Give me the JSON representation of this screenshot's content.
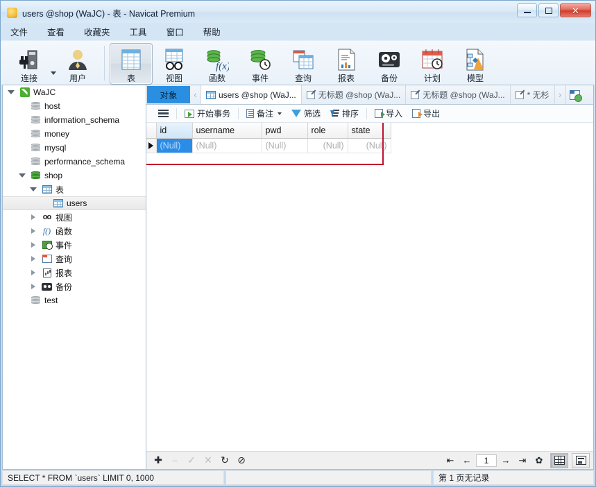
{
  "window": {
    "title": "users @shop (WaJC) - 表 - Navicat Premium",
    "icon": "app-icon",
    "minimize_label": "最小化",
    "maximize_label": "最大化",
    "close_label": "关闭"
  },
  "menu": {
    "items": [
      {
        "label": "文件",
        "name": "menu-file"
      },
      {
        "label": "查看",
        "name": "menu-view"
      },
      {
        "label": "收藏夹",
        "name": "menu-favorites"
      },
      {
        "label": "工具",
        "name": "menu-tools"
      },
      {
        "label": "窗口",
        "name": "menu-window"
      },
      {
        "label": "帮助",
        "name": "menu-help"
      }
    ]
  },
  "toolbar": {
    "items": [
      {
        "label": "连接",
        "icon": "connection-icon",
        "selected": false
      },
      {
        "label": "用户",
        "icon": "user-icon",
        "selected": false
      },
      {
        "label": "表",
        "icon": "table-icon",
        "selected": true
      },
      {
        "label": "视图",
        "icon": "view-icon",
        "selected": false
      },
      {
        "label": "函数",
        "icon": "function-icon",
        "selected": false
      },
      {
        "label": "事件",
        "icon": "event-icon",
        "selected": false
      },
      {
        "label": "查询",
        "icon": "query-icon",
        "selected": false
      },
      {
        "label": "报表",
        "icon": "report-icon",
        "selected": false
      },
      {
        "label": "备份",
        "icon": "backup-icon",
        "selected": false
      },
      {
        "label": "计划",
        "icon": "schedule-icon",
        "selected": false
      },
      {
        "label": "模型",
        "icon": "model-icon",
        "selected": false
      }
    ]
  },
  "sidebar": {
    "tree": [
      {
        "label": "WaJC",
        "indent": 0,
        "icon": "connection",
        "expander": "open",
        "selected": false
      },
      {
        "label": "host",
        "indent": 1,
        "icon": "db-grey",
        "expander": "none",
        "selected": false
      },
      {
        "label": "information_schema",
        "indent": 1,
        "icon": "db-grey",
        "expander": "none",
        "selected": false
      },
      {
        "label": "money",
        "indent": 1,
        "icon": "db-grey",
        "expander": "none",
        "selected": false
      },
      {
        "label": "mysql",
        "indent": 1,
        "icon": "db-grey",
        "expander": "none",
        "selected": false
      },
      {
        "label": "performance_schema",
        "indent": 1,
        "icon": "db-grey",
        "expander": "none",
        "selected": false
      },
      {
        "label": "shop",
        "indent": 1,
        "icon": "db-green",
        "expander": "open",
        "selected": false
      },
      {
        "label": "表",
        "indent": 2,
        "icon": "table",
        "expander": "open",
        "selected": false
      },
      {
        "label": "users",
        "indent": 3,
        "icon": "table",
        "expander": "none",
        "selected": true
      },
      {
        "label": "视图",
        "indent": 2,
        "icon": "view",
        "expander": "closed",
        "selected": false
      },
      {
        "label": "函数",
        "indent": 2,
        "icon": "function",
        "expander": "closed",
        "selected": false
      },
      {
        "label": "事件",
        "indent": 2,
        "icon": "event",
        "expander": "closed",
        "selected": false
      },
      {
        "label": "查询",
        "indent": 2,
        "icon": "query",
        "expander": "closed",
        "selected": false
      },
      {
        "label": "报表",
        "indent": 2,
        "icon": "report",
        "expander": "closed",
        "selected": false
      },
      {
        "label": "备份",
        "indent": 2,
        "icon": "backup",
        "expander": "closed",
        "selected": false
      },
      {
        "label": "test",
        "indent": 1,
        "icon": "db-grey",
        "expander": "none",
        "selected": false
      }
    ]
  },
  "tabs": {
    "objects_label": "对象",
    "documents": [
      {
        "label": "users @shop (WaJ...",
        "icon": "table-icon",
        "active": true
      },
      {
        "label": "无标题 @shop (WaJ...",
        "icon": "query-icon",
        "active": false
      },
      {
        "label": "无标题 @shop (WaJ...",
        "icon": "query-icon",
        "active": false
      },
      {
        "label": "* 无杉",
        "icon": "query-icon",
        "active": false
      }
    ],
    "scroll_right_label": "›",
    "new_tab_label": "新建"
  },
  "data_toolbar": {
    "menu_label": "",
    "items": [
      {
        "label": "开始事务",
        "icon": "begin-transaction-icon",
        "dropdown": false
      },
      {
        "label": "备注",
        "icon": "note-icon",
        "dropdown": true
      },
      {
        "label": "筛选",
        "icon": "filter-icon",
        "dropdown": false
      },
      {
        "label": "排序",
        "icon": "sort-icon",
        "dropdown": false
      },
      {
        "label": "导入",
        "icon": "import-icon",
        "dropdown": false
      },
      {
        "label": "导出",
        "icon": "export-icon",
        "dropdown": false
      }
    ]
  },
  "grid": {
    "columns": [
      {
        "label": "id",
        "width": 52,
        "align": "left",
        "highlighted": true
      },
      {
        "label": "username",
        "width": 100,
        "align": "left",
        "highlighted": false
      },
      {
        "label": "pwd",
        "width": 66,
        "align": "left",
        "highlighted": false
      },
      {
        "label": "role",
        "width": 58,
        "align": "right",
        "highlighted": false
      },
      {
        "label": "state",
        "width": 62,
        "align": "right",
        "highlighted": false
      }
    ],
    "rows": [
      {
        "indicator": "current-row",
        "cells": [
          {
            "value": "(Null)",
            "selected": true,
            "align": "left"
          },
          {
            "value": "(Null)",
            "selected": false,
            "align": "left"
          },
          {
            "value": "(Null)",
            "selected": false,
            "align": "left"
          },
          {
            "value": "(Null)",
            "selected": false,
            "align": "right"
          },
          {
            "value": "(Null)",
            "selected": false,
            "align": "right"
          }
        ]
      }
    ],
    "annotation_color": "#c0112f"
  },
  "bottombar": {
    "record_actions": [
      {
        "icon": "add-record-icon",
        "glyph": "✚",
        "enabled": true
      },
      {
        "icon": "delete-record-icon",
        "glyph": "−",
        "enabled": false
      },
      {
        "icon": "apply-change-icon",
        "glyph": "✓",
        "enabled": false
      },
      {
        "icon": "cancel-change-icon",
        "glyph": "✕",
        "enabled": false
      },
      {
        "icon": "refresh-icon",
        "glyph": "↻",
        "enabled": true
      },
      {
        "icon": "stop-icon",
        "glyph": "⊘",
        "enabled": true
      }
    ],
    "nav": [
      {
        "icon": "first-record-icon",
        "glyph": "⇤"
      },
      {
        "icon": "prev-record-icon",
        "glyph": "←"
      },
      {
        "icon": "next-record-icon",
        "glyph": "→"
      },
      {
        "icon": "last-record-icon",
        "glyph": "⇥"
      },
      {
        "icon": "settings-icon",
        "glyph": "✦"
      }
    ],
    "page_value": "1",
    "view_grid_label": "网格查看",
    "view_form_label": "表单查看"
  },
  "statusbar": {
    "sql": "SELECT * FROM `users` LIMIT 0, 1000",
    "info": "第 1 页无记录"
  }
}
